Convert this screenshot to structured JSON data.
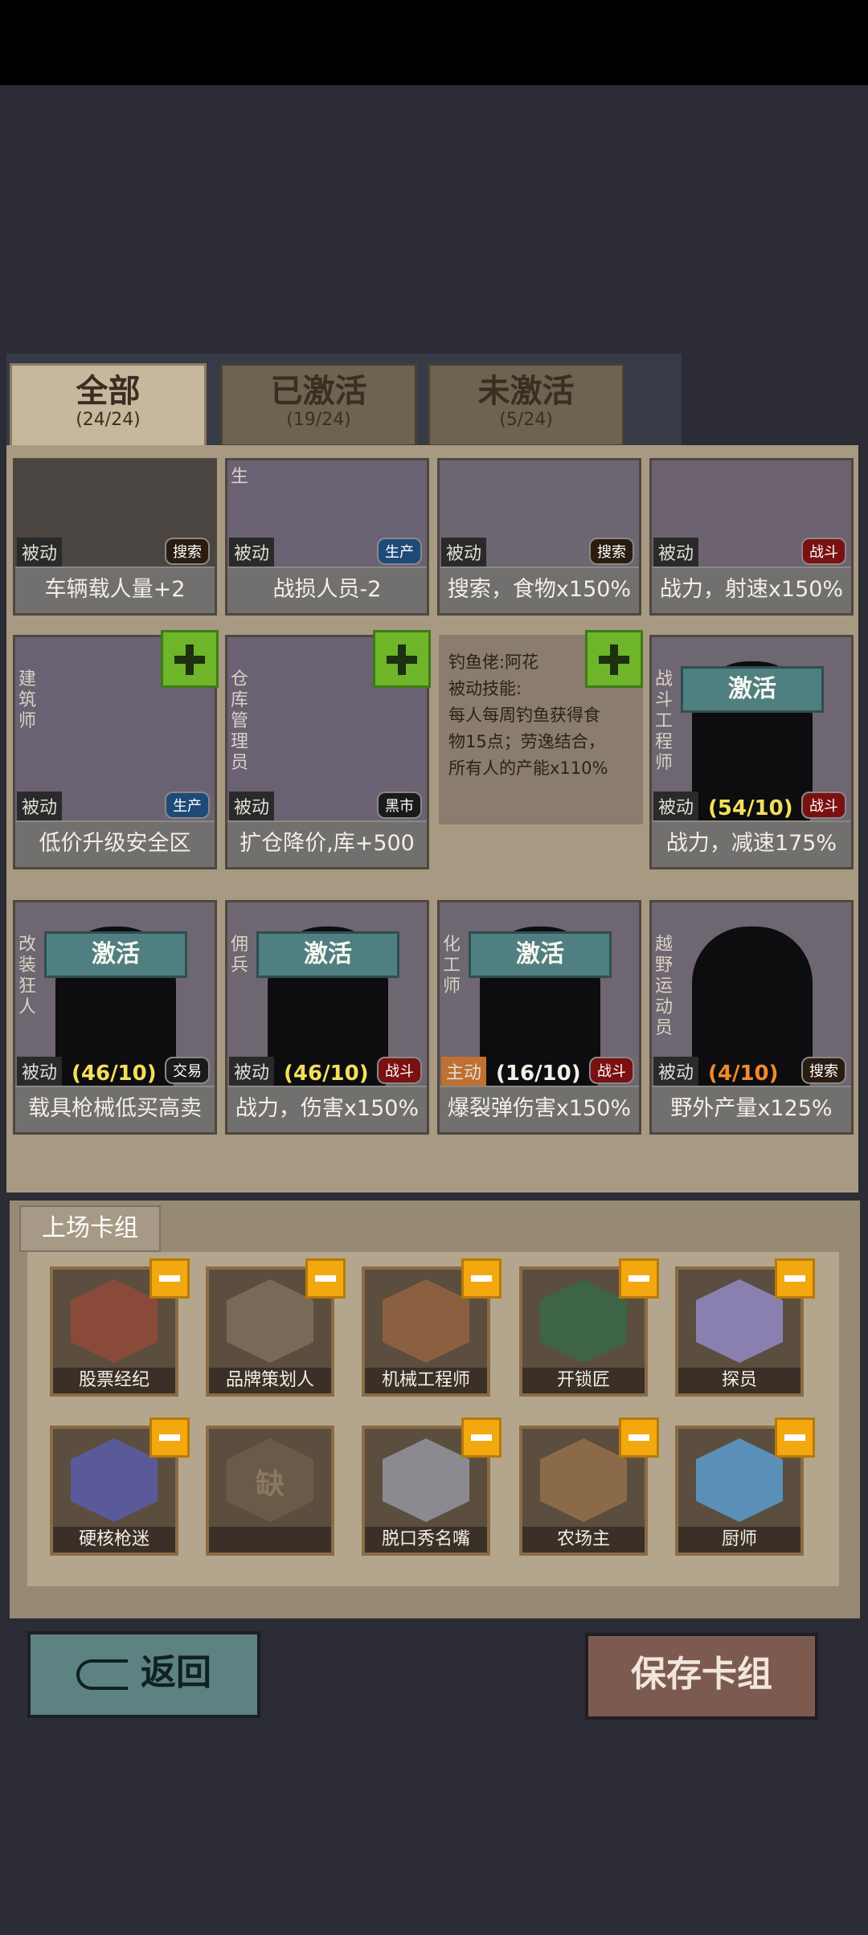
{
  "tabs": [
    {
      "label": "全部",
      "count": "(24/24)"
    },
    {
      "label": "已激活",
      "count": "(19/24)"
    },
    {
      "label": "未激活",
      "count": "(5/24)"
    }
  ],
  "cards_row1": [
    {
      "kind": "被动",
      "tag": "搜索",
      "footer": "车辆载人量+2",
      "vlabel": ""
    },
    {
      "kind": "被动",
      "tag": "生产",
      "footer": "战损人员-2",
      "vlabel": "生"
    },
    {
      "kind": "被动",
      "tag": "搜索",
      "footer": "搜索，食物x150%",
      "vlabel": ""
    },
    {
      "kind": "被动",
      "tag": "战斗",
      "footer": "战力，射速x150%",
      "vlabel": ""
    }
  ],
  "cards_row2": [
    {
      "kind": "被动",
      "tag": "生产",
      "footer": "低价升级安全区",
      "vlabel": "建筑师"
    },
    {
      "kind": "被动",
      "tag": "黑市",
      "footer": "扩仓降价,库+500",
      "vlabel": "仓库管理员"
    },
    {
      "kind": "被动",
      "tag": "战斗",
      "footer": "战力，减速175%",
      "vlabel": "战斗工程师",
      "activate": "激活",
      "progress": "(54/10)"
    }
  ],
  "skill_detail": {
    "title": "钓鱼佬:阿花",
    "subtitle": "被动技能:",
    "line1": "每人每周钓鱼获得食",
    "line2": "物15点；劳逸结合，",
    "line3": "所有人的产能x110%"
  },
  "cards_row3": [
    {
      "kind": "被动",
      "tag": "交易",
      "footer": "载具枪械低买高卖",
      "vlabel": "改装狂人",
      "activate": "激活",
      "progress": "(46/10)"
    },
    {
      "kind": "被动",
      "tag": "战斗",
      "footer": "战力，伤害x150%",
      "vlabel": "佣兵",
      "activate": "激活",
      "progress": "(46/10)"
    },
    {
      "kind": "主动",
      "tag": "战斗",
      "footer": "爆裂弹伤害x150%",
      "vlabel": "化工师",
      "activate": "激活",
      "progress": "(16/10)"
    },
    {
      "kind": "被动",
      "tag": "搜索",
      "footer": "野外产量x125%",
      "vlabel": "越野运动员",
      "progress": "(4/10)"
    }
  ],
  "deck": {
    "title": "上场卡组",
    "slots": [
      "股票经纪",
      "品牌策划人",
      "机械工程师",
      "开锁匠",
      "探员",
      "硬核枪迷",
      "",
      "脱口秀名嘴",
      "农场主",
      "厨师"
    ],
    "missing_label": "缺"
  },
  "buttons": {
    "back": "返回",
    "save": "保存卡组"
  }
}
